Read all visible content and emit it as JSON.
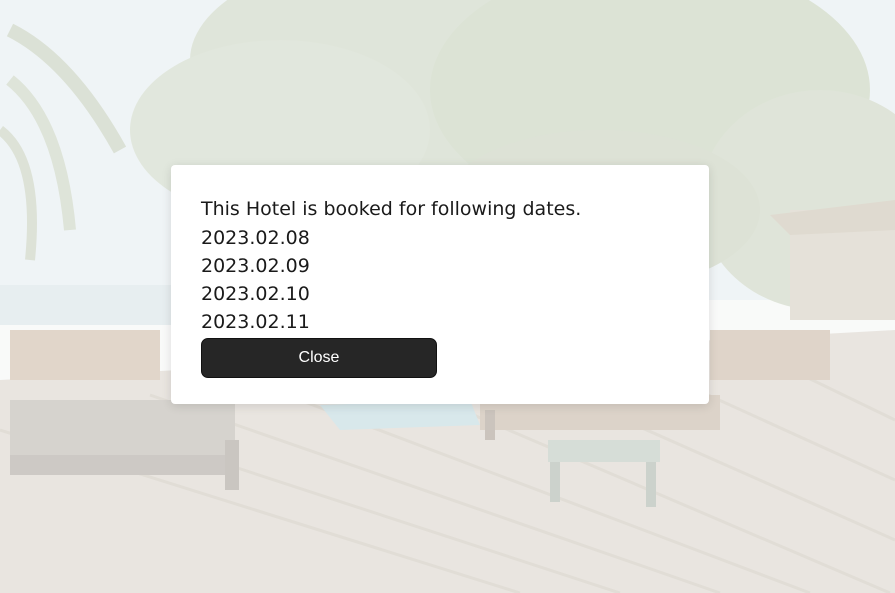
{
  "dialog": {
    "message": "This Hotel is booked for following dates.",
    "dates": [
      "2023.02.08",
      "2023.02.09",
      "2023.02.10",
      "2023.02.11"
    ],
    "close_label": "Close"
  },
  "colors": {
    "button_bg": "#262626",
    "button_text": "#ffffff",
    "modal_bg": "#ffffff"
  }
}
